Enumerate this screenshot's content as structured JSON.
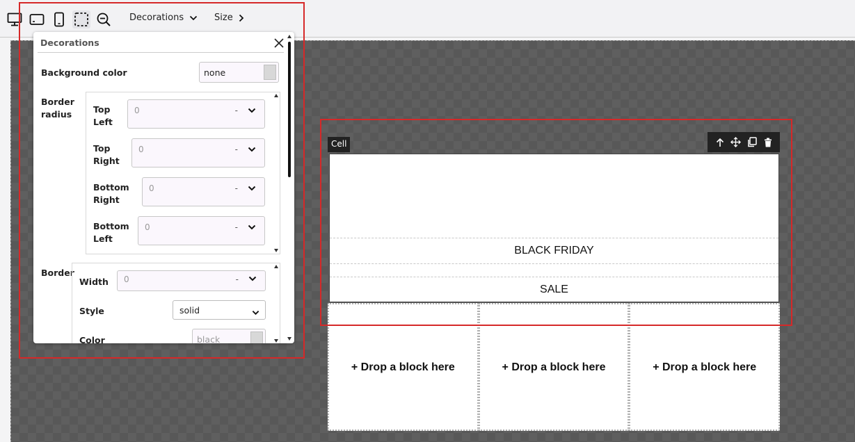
{
  "toolbar": {
    "icons": [
      "desktop-icon",
      "tablet-landscape-icon",
      "mobile-icon",
      "selection-icon",
      "zoom-out-icon"
    ],
    "decorations_menu": "Decorations",
    "size_menu": "Size"
  },
  "panel": {
    "title": "Decorations",
    "background_color": {
      "label": "Background color",
      "value": "none"
    },
    "border_radius": {
      "label": "Border radius",
      "corners": [
        {
          "label": "Top Left",
          "value": "0",
          "unit": "-"
        },
        {
          "label": "Top Right",
          "value": "0",
          "unit": "-"
        },
        {
          "label": "Bottom Right",
          "value": "0",
          "unit": "-"
        },
        {
          "label": "Bottom Left",
          "value": "0",
          "unit": "-"
        }
      ]
    },
    "border": {
      "label": "Border",
      "width": {
        "label": "Width",
        "value": "0",
        "unit": "-"
      },
      "style": {
        "label": "Style",
        "value": "solid"
      },
      "color": {
        "label": "Color",
        "value": "black"
      }
    }
  },
  "cell": {
    "tag": "Cell",
    "tools": [
      "arrow-up-icon",
      "move-icon",
      "copy-icon",
      "trash-icon"
    ],
    "line1": "BLACK FRIDAY",
    "line2": "SALE"
  },
  "drops": [
    "+ Drop a block here",
    "+ Drop a block here",
    "+ Drop a block here"
  ],
  "colors": {
    "highlight": "#d62828",
    "canvas": "#585858"
  }
}
